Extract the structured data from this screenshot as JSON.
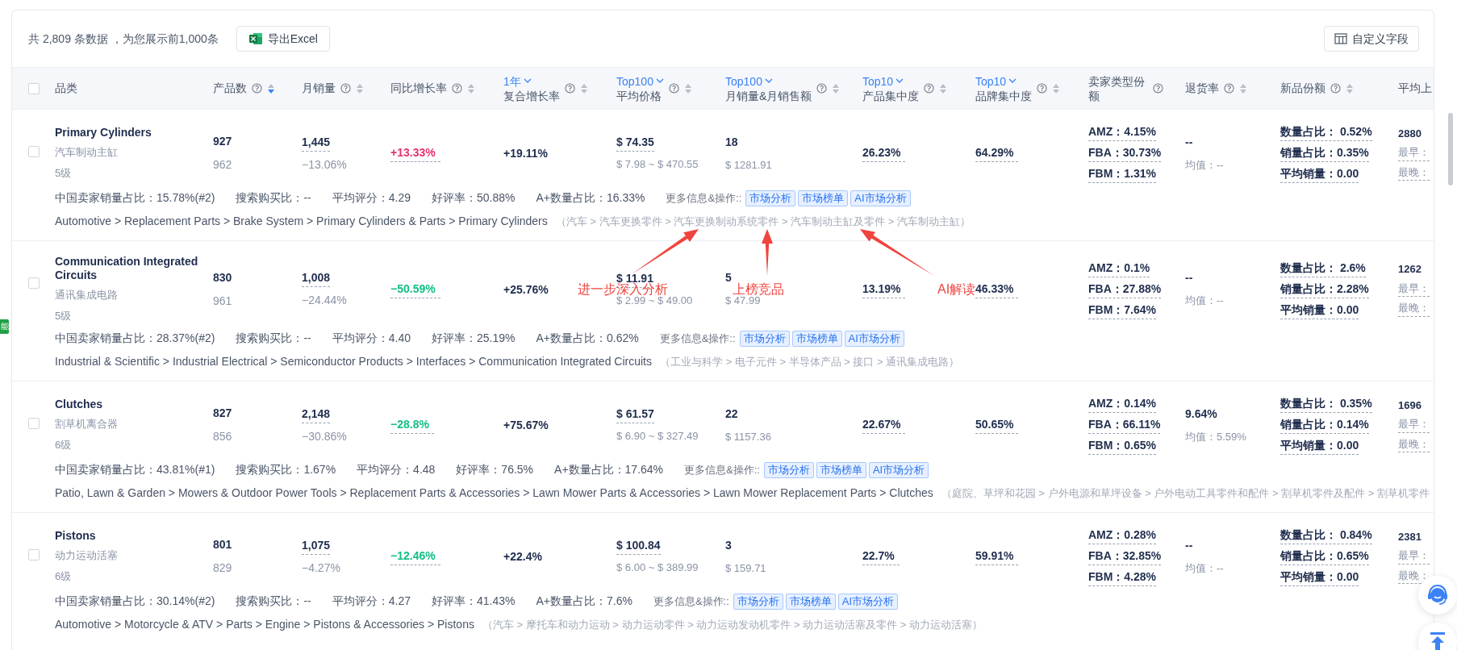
{
  "summary": "共 2,809 条数据 ，为您展示前1,000条",
  "export_button": "导出Excel",
  "custom_fields_button": "自定义字段",
  "side_tab": "能",
  "all_selected": false,
  "columns": [
    {
      "label": "品类",
      "help": false,
      "sortable": false
    },
    {
      "label": "产品数",
      "help": true,
      "sortable": true,
      "sorted_descending": true
    },
    {
      "label": "月销量",
      "help": true,
      "sortable": true,
      "sorted_descending": false
    },
    {
      "label": "同比增长率",
      "help": true,
      "sortable": true,
      "sorted_descending": false
    },
    {
      "selector": "1年",
      "label": "复合增长率",
      "help": true,
      "sortable": true,
      "sorted_descending": false
    },
    {
      "selector": "Top100",
      "label": "平均价格",
      "help": true,
      "sortable": true,
      "sorted_descending": false
    },
    {
      "selector": "Top100",
      "label": "月销量&月销售额",
      "help": true,
      "sortable": true,
      "sorted_descending": false
    },
    {
      "selector": "Top10",
      "label": "产品集中度",
      "help": true,
      "sortable": true,
      "sorted_descending": false
    },
    {
      "selector": "Top10",
      "label": "品牌集中度",
      "help": true,
      "sortable": true,
      "sorted_descending": false
    },
    {
      "label": "卖家类型份额",
      "help": true,
      "sortable": false
    },
    {
      "label": "退货率",
      "help": true,
      "sortable": true,
      "sorted_descending": false
    },
    {
      "label": "新品份额",
      "help": true,
      "sortable": true,
      "sorted_descending": false
    },
    {
      "label": "平均上",
      "help": false,
      "sortable": false
    }
  ],
  "rows": [
    {
      "selected": false,
      "name": "Primary Cylinders",
      "name_cn": "汽车制动主缸",
      "level": "5级",
      "products": "927",
      "products_prev": "962",
      "sales": "1,445",
      "sales_change": "−13.06%",
      "yoy": "+13.33%",
      "yoy_rising": true,
      "cagr": "+19.11%",
      "avg_price": "$ 74.35",
      "price_range": "$ 7.98 ~ $ 470.55",
      "top_sales": "18",
      "top_revenue": "$ 1281.91",
      "product_conc": "26.23%",
      "brand_conc": "64.29%",
      "seller_shares": [
        "AMZ：4.15%",
        "FBA：30.73%",
        "FBM：1.31%"
      ],
      "return_rate": "--",
      "return_avg": "均值：--",
      "new_share": [
        "数量占比： 0.52%",
        "销量占比：0.35%",
        "平均销量：0.00"
      ],
      "launch": [
        "2880",
        "最早：",
        "最晚："
      ],
      "stats": [
        "中国卖家销量占比：15.78%(#2)",
        "搜索购买比：--",
        "平均评分：4.29",
        "好评率：50.88%",
        "A+数量占比：16.33%"
      ],
      "more_label": "更多信息&操作::",
      "actions": [
        "市场分析",
        "市场榜单",
        "AI市场分析"
      ],
      "path_en": "Automotive > Replacement Parts > Brake System > Primary Cylinders & Parts > Primary Cylinders",
      "path_cn": "（汽车 > 汽车更换零件 > 汽车更换制动系统零件 > 汽车制动主缸及零件 > 汽车制动主缸）"
    },
    {
      "selected": false,
      "name": "Communication Integrated Circuits",
      "name_cn": "通讯集成电路",
      "level": "5级",
      "products": "830",
      "products_prev": "961",
      "sales": "1,008",
      "sales_change": "−24.44%",
      "yoy": "−50.59%",
      "yoy_rising": false,
      "cagr": "+25.76%",
      "avg_price": "$ 11.91",
      "price_range": "$ 2.99 ~ $ 49.00",
      "top_sales": "5",
      "top_revenue": "$ 47.99",
      "product_conc": "13.19%",
      "brand_conc": "46.33%",
      "seller_shares": [
        "AMZ：0.1%",
        "FBA：27.88%",
        "FBM：7.64%"
      ],
      "return_rate": "--",
      "return_avg": "均值：--",
      "new_share": [
        "数量占比： 2.6%",
        "销量占比：2.28%",
        "平均销量：0.00"
      ],
      "launch": [
        "1262",
        "最早：",
        "最晚："
      ],
      "stats": [
        "中国卖家销量占比：28.37%(#2)",
        "搜索购买比：--",
        "平均评分：4.40",
        "好评率：25.19%",
        "A+数量占比：0.62%"
      ],
      "more_label": "更多信息&操作::",
      "actions": [
        "市场分析",
        "市场榜单",
        "AI市场分析"
      ],
      "path_en": "Industrial & Scientific > Industrial Electrical > Semiconductor Products > Interfaces > Communication Integrated Circuits",
      "path_cn": "（工业与科学 > 电子元件 > 半导体产品 > 接口 > 通讯集成电路）"
    },
    {
      "selected": false,
      "name": "Clutches",
      "name_cn": "割草机离合器",
      "level": "6级",
      "products": "827",
      "products_prev": "856",
      "sales": "2,148",
      "sales_change": "−30.86%",
      "yoy": "−28.8%",
      "yoy_rising": false,
      "cagr": "+75.67%",
      "avg_price": "$ 61.57",
      "price_range": "$ 6.90 ~ $ 327.49",
      "top_sales": "22",
      "top_revenue": "$ 1157.36",
      "product_conc": "22.67%",
      "brand_conc": "50.65%",
      "seller_shares": [
        "AMZ：0.14%",
        "FBA：66.11%",
        "FBM：0.65%"
      ],
      "return_rate": "9.64%",
      "return_avg": "均值：5.59%",
      "new_share": [
        "数量占比： 0.35%",
        "销量占比：0.14%",
        "平均销量：0.00"
      ],
      "launch": [
        "1696",
        "最早：",
        "最晚："
      ],
      "stats": [
        "中国卖家销量占比：43.81%(#1)",
        "搜索购买比：1.67%",
        "平均评分：4.48",
        "好评率：76.5%",
        "A+数量占比：17.64%"
      ],
      "more_label": "更多信息&操作::",
      "actions": [
        "市场分析",
        "市场榜单",
        "AI市场分析"
      ],
      "path_en": "Patio, Lawn & Garden > Mowers & Outdoor Power Tools > Replacement Parts & Accessories > Lawn Mower Parts & Accessories > Lawn Mower Replacement Parts > Clutches",
      "path_cn": "（庭院、草坪和花园 > 户外电源和草坪设备 > 户外电动工具零件和配件 > 割草机零件及配件 > 割草机零件"
    },
    {
      "selected": false,
      "name": "Pistons",
      "name_cn": "动力运动活塞",
      "level": "6级",
      "products": "801",
      "products_prev": "829",
      "sales": "1,075",
      "sales_change": "−4.27%",
      "yoy": "−12.46%",
      "yoy_rising": false,
      "cagr": "+22.4%",
      "avg_price": "$ 100.84",
      "price_range": "$ 6.00 ~ $ 389.99",
      "top_sales": "3",
      "top_revenue": "$ 159.71",
      "product_conc": "22.7%",
      "brand_conc": "59.91%",
      "seller_shares": [
        "AMZ：0.28%",
        "FBA：32.85%",
        "FBM：4.28%"
      ],
      "return_rate": "--",
      "return_avg": "均值：--",
      "new_share": [
        "数量占比： 0.84%",
        "销量占比：0.65%",
        "平均销量：0.00"
      ],
      "launch": [
        "2381",
        "最早：",
        "最晚："
      ],
      "stats": [
        "中国卖家销量占比：30.14%(#2)",
        "搜索购买比：--",
        "平均评分：4.27",
        "好评率：41.43%",
        "A+数量占比：7.6%"
      ],
      "more_label": "更多信息&操作::",
      "actions": [
        "市场分析",
        "市场榜单",
        "AI市场分析"
      ],
      "path_en": "Automotive > Motorcycle & ATV > Parts > Engine > Pistons & Accessories > Pistons",
      "path_cn": "（汽车 > 摩托车和动力运动 > 动力运动零件 > 动力运动发动机零件 > 动力运动活塞及零件 > 动力运动活塞）"
    }
  ],
  "annotations": [
    {
      "text": "进一步深入分析"
    },
    {
      "text": "上榜竞品"
    },
    {
      "text": "AI解读"
    }
  ]
}
